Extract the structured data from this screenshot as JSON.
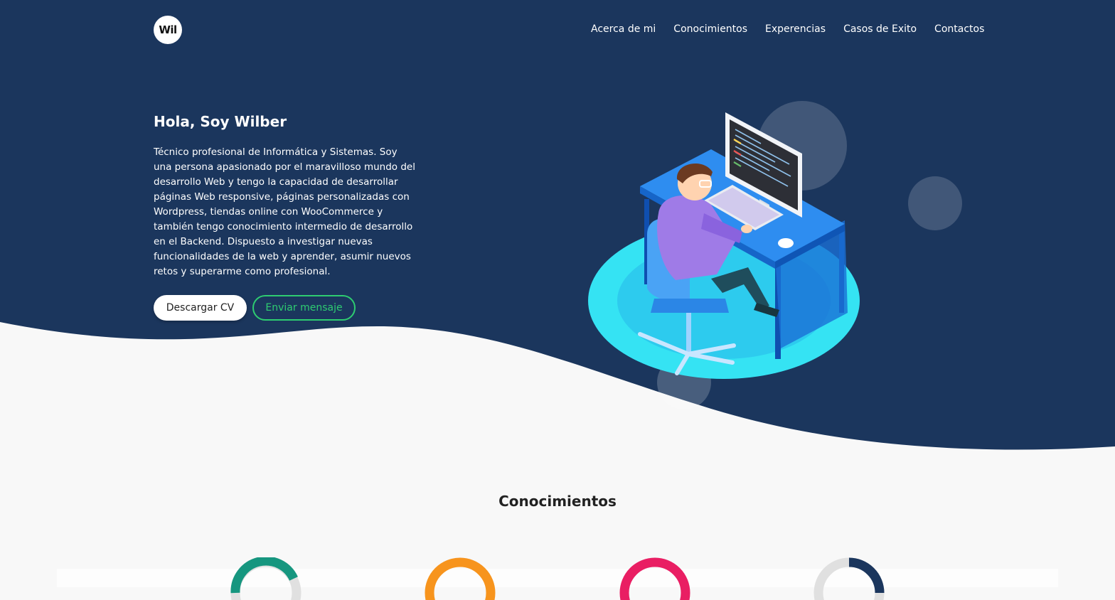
{
  "brand": {
    "logo_text": "Wil",
    "colors": {
      "hero_bg": "#1b365d",
      "accent_green": "#2ecc71"
    }
  },
  "nav": {
    "items": [
      "Acerca de mi",
      "Conocimientos",
      "Experencias",
      "Casos de Exito",
      "Contactos"
    ]
  },
  "hero": {
    "title": "Hola, Soy Wilber",
    "description": "Técnico profesional de Informática y Sistemas. Soy una persona apasionado por el maravilloso mundo del desarrollo Web y tengo la capacidad de desarrollar páginas Web responsive, páginas personalizadas con Wordpress, tiendas online con WooCommerce y también tengo conocimiento intermedio de desarrollo en el Backend. Dispuesto a investigar nuevas funcionalidades de la web y aprender, asumir nuevos retos y superarme como profesional.",
    "buttons": {
      "download_cv": "Descargar CV",
      "send_message": "Enviar mensaje"
    }
  },
  "skills": {
    "title": "Conocimientos",
    "rings": [
      {
        "color": "#16967f",
        "track": "#e0e0e0"
      },
      {
        "color": "#f7941d",
        "track": "#e0e0e0"
      },
      {
        "color": "#e91e63",
        "track": "#e0e0e0"
      },
      {
        "color": "#1b365d",
        "track": "#e0e0e0"
      }
    ]
  }
}
